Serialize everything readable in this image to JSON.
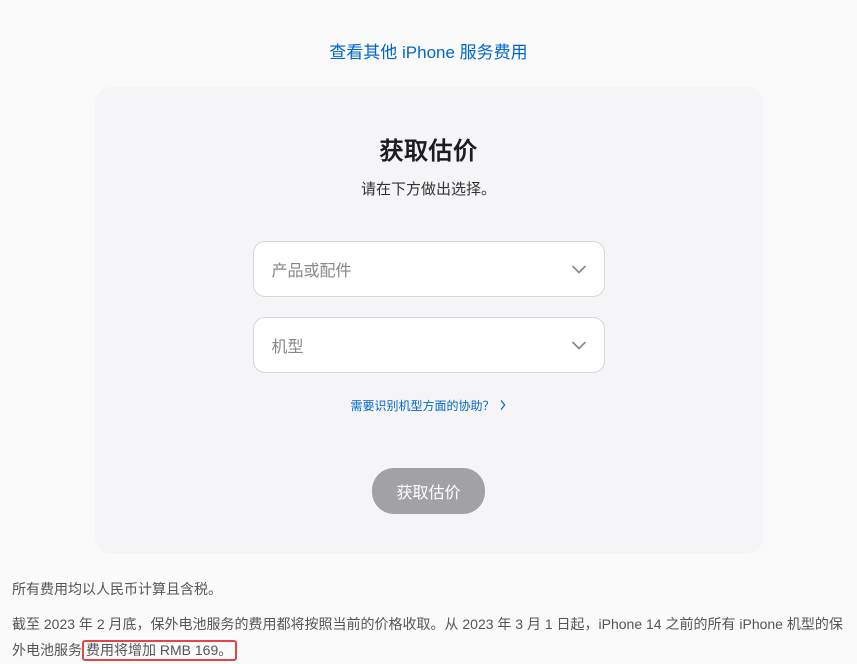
{
  "topLink": "查看其他 iPhone 服务费用",
  "card": {
    "title": "获取估价",
    "subtitle": "请在下方做出选择。",
    "select1Placeholder": "产品或配件",
    "select2Placeholder": "机型",
    "helpLink": "需要识别机型方面的协助？",
    "submit": "获取估价"
  },
  "notes": {
    "line1": "所有费用均以人民币计算且含税。",
    "line2a": "截至 2023 年 2 月底，保外电池服务的费用都将按照当前的价格收取。从 2023 年 3 月 1 日起，iPhone 14 之前的所有 iPhone 机型的保外电池服务",
    "line2b": "费用将增加 RMB 169。"
  }
}
